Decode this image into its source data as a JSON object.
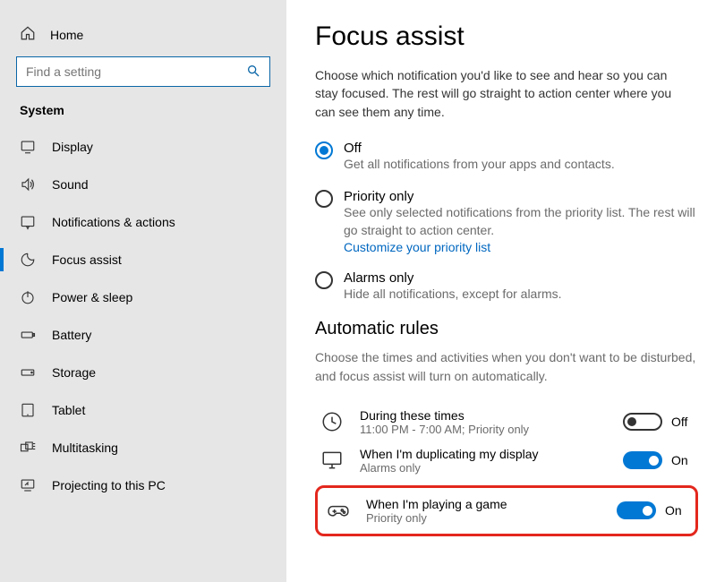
{
  "sidebar": {
    "home": "Home",
    "search_placeholder": "Find a setting",
    "category": "System",
    "items": [
      {
        "label": "Display"
      },
      {
        "label": "Sound"
      },
      {
        "label": "Notifications & actions"
      },
      {
        "label": "Focus assist"
      },
      {
        "label": "Power & sleep"
      },
      {
        "label": "Battery"
      },
      {
        "label": "Storage"
      },
      {
        "label": "Tablet"
      },
      {
        "label": "Multitasking"
      },
      {
        "label": "Projecting to this PC"
      }
    ]
  },
  "main": {
    "title": "Focus assist",
    "desc": "Choose which notification you'd like to see and hear so you can stay focused. The rest will go straight to action center where you can see them any time.",
    "options": {
      "off": {
        "label": "Off",
        "hint": "Get all notifications from your apps and contacts."
      },
      "priority": {
        "label": "Priority only",
        "hint": "See only selected notifications from the priority list. The rest will go straight to action center.",
        "link": "Customize your priority list"
      },
      "alarms": {
        "label": "Alarms only",
        "hint": "Hide all notifications, except for alarms."
      }
    },
    "rules": {
      "heading": "Automatic rules",
      "desc": "Choose the times and activities when you don't want to be disturbed, and focus assist will turn on automatically.",
      "items": {
        "times": {
          "label": "During these times",
          "hint": "11:00 PM - 7:00 AM; Priority only",
          "state": "Off"
        },
        "duplicating": {
          "label": "When I'm duplicating my display",
          "hint": "Alarms only",
          "state": "On"
        },
        "gaming": {
          "label": "When I'm playing a game",
          "hint": "Priority only",
          "state": "On"
        }
      }
    }
  }
}
